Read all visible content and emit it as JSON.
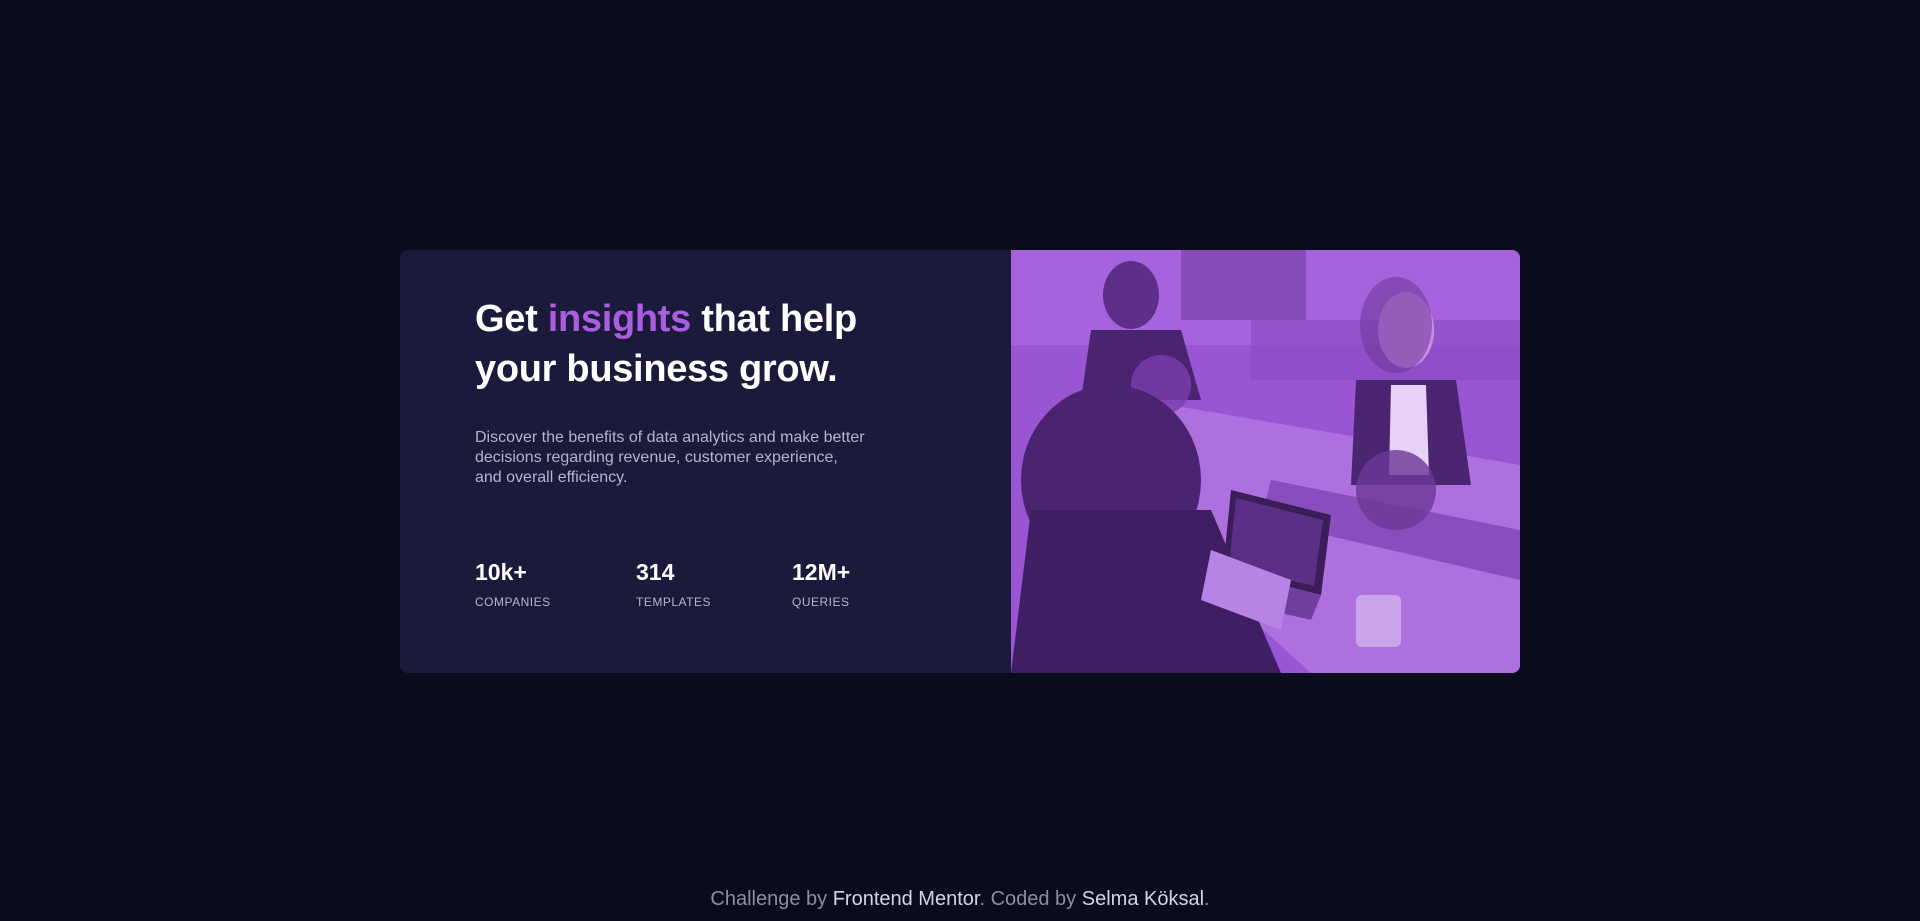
{
  "card": {
    "headline": {
      "before": "Get ",
      "accent": "insights",
      "after": " that help your business grow."
    },
    "description": "Discover the benefits of data analytics and make better decisions regarding revenue, customer experience, and overall efficiency.",
    "stats": [
      {
        "value": "10k+",
        "label": "COMPANIES"
      },
      {
        "value": "314",
        "label": "TEMPLATES"
      },
      {
        "value": "12M+",
        "label": "QUERIES"
      }
    ],
    "image": {
      "alt": ""
    }
  },
  "attribution": {
    "prefix": "Challenge by ",
    "challenge_link": "Frontend Mentor",
    "middle": ". Coded by ",
    "author_link": "Selma Köksal",
    "suffix": "."
  },
  "colors": {
    "background": "#090c1c",
    "card": "#1c1a3a",
    "accent": "#a95ee0",
    "image_overlay": "#9c55d6",
    "muted_text": "#b9b3cd"
  }
}
